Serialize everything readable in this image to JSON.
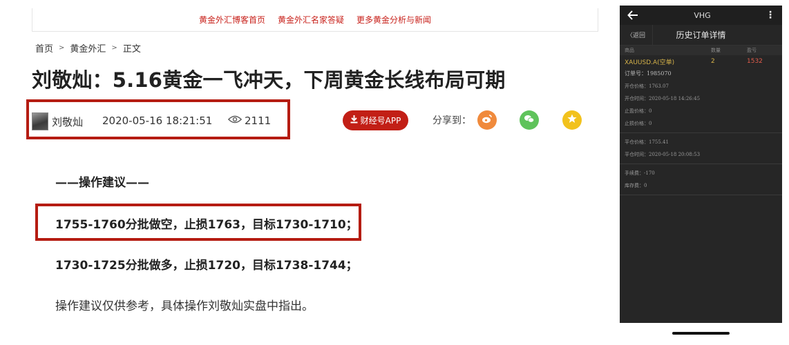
{
  "topnav": [
    "黄金外汇博客首页",
    "黄金外汇名家答疑",
    "更多黄金分析与新闻"
  ],
  "breadcrumb": {
    "home": "首页",
    "category": "黄金外汇",
    "current": "正文",
    "separator": ">"
  },
  "article": {
    "title": "刘敬灿：5.16黄金一飞冲天，下周黄金长线布局可期",
    "author": "刘敬灿",
    "datetime": "2020-05-16 18:21:51",
    "views": "2111",
    "app_button": "财经号APP",
    "share_label": "分享到：",
    "section_heading": "——操作建议——",
    "line1": "1755-1760分批做空，止损1763，目标1730-1710；",
    "line2": "1730-1725分批做多，止损1720，目标1738-1744；",
    "line3": "操作建议仅供参考，具体操作刘敬灿实盘中指出。"
  },
  "phone": {
    "app_name": "VHG",
    "back_label": "〈返回",
    "title": "历史订单详情",
    "columns": [
      "商品",
      "数量",
      "盈亏"
    ],
    "symbol": "XAUUSD.A(空单)",
    "quantity": "2",
    "profit": "1532",
    "order_no": "订单号：1985070",
    "open_price": "开仓价格：1763.07",
    "open_time": "开仓时间：2020-05-18 14:26:45",
    "take_profit": "止盈价格：0",
    "stop_loss": "止损价格：0",
    "close_price": "平仓价格：1755.41",
    "close_time": "平仓时间：2020-05-18 20:08:53",
    "fee": "手续费：-170",
    "swap": "库存费：0"
  },
  "colors": {
    "accent_red": "#c21f16",
    "box_red": "#b51c12",
    "phone_bg": "#262626",
    "gold": "#d6b34a",
    "loss_red": "#e05c4b"
  },
  "icons": [
    "eye-icon",
    "download-icon",
    "weibo-icon",
    "wechat-icon",
    "star-icon",
    "back-arrow-icon",
    "more-icon"
  ]
}
